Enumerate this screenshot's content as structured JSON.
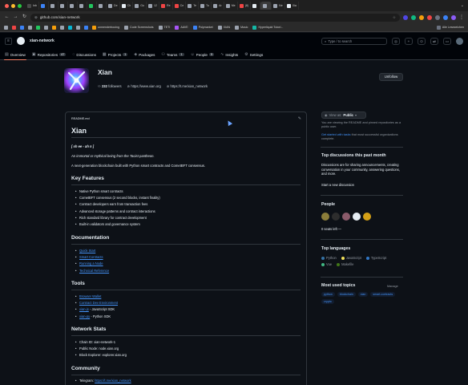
{
  "browser": {
    "tabs": [
      {
        "label": "Inb",
        "color": "#4a4a4a"
      },
      {
        "label": "",
        "color": "#3b82f6"
      },
      {
        "label": "",
        "color": "#9ca3af"
      },
      {
        "label": "",
        "color": "#9ca3af"
      },
      {
        "label": "",
        "color": "#9ca3af"
      },
      {
        "label": "",
        "color": "#9ca3af"
      },
      {
        "label": "",
        "color": "#22c55e"
      },
      {
        "label": "",
        "color": "#9ca3af"
      },
      {
        "label": "De",
        "color": "#9ca3af"
      },
      {
        "label": "Ch",
        "color": "#e6edf3"
      },
      {
        "label": "Go",
        "color": "#9ca3af"
      },
      {
        "label": "12",
        "color": "#9ca3af"
      },
      {
        "label": "Re",
        "color": "#ef4444"
      },
      {
        "label": "Ce",
        "color": "#ef4444"
      },
      {
        "label": "Te",
        "color": "#9ca3af"
      },
      {
        "label": "Tu",
        "color": "#9ca3af"
      },
      {
        "label": "Ar",
        "color": "#9ca3af"
      },
      {
        "label": "Me",
        "color": "#9ca3af"
      },
      {
        "label": "(8)",
        "color": "#ef4444"
      },
      {
        "label": "",
        "color": "#e6edf3"
      },
      {
        "label": "",
        "color": "#9ca3af",
        "active": true
      },
      {
        "label": "Ne",
        "color": "#9ca3af"
      },
      {
        "label": "Xia",
        "color": "#e6edf3"
      }
    ],
    "url": "github.com/xian-network",
    "bookmarks": [
      {
        "label": "unmenderbooing",
        "color": "#f59e0b"
      },
      {
        "label": "Code Screenshots",
        "color": "#9ca3af"
      },
      {
        "label": "TETI",
        "color": "#9ca3af"
      },
      {
        "label": "AAVE",
        "color": "#a855f7"
      },
      {
        "label": "Polymarket",
        "color": "#3b82f6"
      },
      {
        "label": "XIAN",
        "color": "#9ca3af"
      },
      {
        "label": "Music",
        "color": "#9ca3af"
      },
      {
        "label": "Hyperliquid Tutori...",
        "color": "#14b8a6"
      }
    ],
    "other_bookmarks": "Alle Lesezeichen"
  },
  "github": {
    "org": "xian-network",
    "search_placeholder": "Type / to search",
    "nav": [
      {
        "label": "Overview",
        "icon": "book-icon",
        "selected": true
      },
      {
        "label": "Repositories",
        "count": "47",
        "icon": "repo-icon"
      },
      {
        "label": "Discussions",
        "icon": "comment-icon"
      },
      {
        "label": "Projects",
        "count": "1",
        "icon": "table-icon"
      },
      {
        "label": "Packages",
        "icon": "package-icon"
      },
      {
        "label": "Teams",
        "count": "1",
        "icon": "people-icon"
      },
      {
        "label": "People",
        "count": "5",
        "icon": "person-icon"
      },
      {
        "label": "Insights",
        "icon": "graph-icon"
      },
      {
        "label": "Settings",
        "icon": "gear-icon"
      }
    ]
  },
  "profile": {
    "name": "Xian",
    "followers": "232",
    "followers_label": "followers",
    "website": "https://www.xian.org",
    "telegram": "https://t.me/xian_network",
    "unfollow": "Unfollow"
  },
  "readme": {
    "filename": "README.md",
    "title": "Xian",
    "pronunciation": "[ sh ee - ah n ]",
    "tagline": "An immortal or mythical being from the Taoist pantheon.",
    "description": "A next-generation blockchain built with Python smart contracts and CometBFT consensus.",
    "features_title": "Key Features",
    "features": [
      "Native Python smart contracts",
      "CometBFT consensus (2 second blocks, instant finality)",
      "Contract developers earn from transaction fees",
      "Advanced storage patterns and contract interactions",
      "Rich standard library for contract development",
      "Built-in validators and governance system"
    ],
    "docs_title": "Documentation",
    "docs": [
      "Quick Start",
      "Smart Contracts",
      "Running a Node",
      "Technical Reference"
    ],
    "tools_title": "Tools",
    "tools": [
      {
        "link": "Browser Wallet",
        "suffix": ""
      },
      {
        "link": "Contract Dev Environment",
        "suffix": ""
      },
      {
        "link": "xian-js",
        "suffix": " - JavaScript SDK"
      },
      {
        "link": "xian-py",
        "suffix": " - Python SDK"
      }
    ],
    "stats_title": "Network Stats",
    "stats": [
      "Chain ID: xian-network-1",
      "Public Node: node.xian.org",
      "Block Explorer: explorer.xian.org"
    ],
    "community_title": "Community",
    "telegram_prefix": "Telegram: ",
    "telegram_link": "https://t.me/xian_network"
  },
  "sidebar": {
    "view_as_label": "View as:",
    "view_as_value": "Public",
    "view_note": "You are viewing the README and pinned repositories as a public user.",
    "tasks_link": "Get started with tasks",
    "tasks_suffix": " that most successful organizations complete.",
    "discussions_title": "Top discussions this past month",
    "discussions_text": "Discussions are for sharing announcements, creating conversation in your community, answering questions, and more.",
    "discussion_link": "Start a new discussion",
    "people_title": "People",
    "people_colors": [
      "#8b7d3a",
      "#2d2d2d",
      "#8a5a6a",
      "#e6edf3",
      "#d4a017"
    ],
    "seats": "0 seats left —",
    "langs_title": "Top languages",
    "languages": [
      {
        "name": "Python",
        "color": "#3572A5"
      },
      {
        "name": "JavaScript",
        "color": "#f1e05a"
      },
      {
        "name": "TypeScript",
        "color": "#3178c6"
      },
      {
        "name": "Vue",
        "color": "#41b883"
      },
      {
        "name": "Makefile",
        "color": "#427819"
      }
    ],
    "topics_title": "Most used topics",
    "manage": "Manage",
    "topics": [
      "python",
      "blockchain",
      "xian",
      "smart-contracts",
      "crypto"
    ]
  }
}
